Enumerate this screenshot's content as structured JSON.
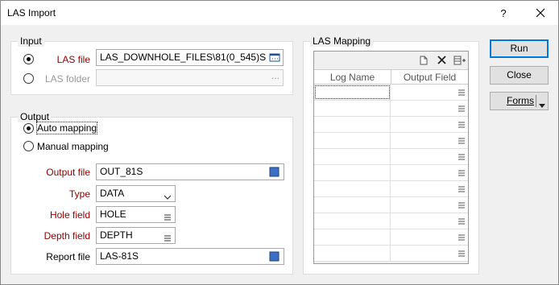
{
  "window": {
    "title": "LAS Import",
    "help_glyph": "?",
    "close_icon": "close-icon"
  },
  "input_group": {
    "label": "Input",
    "las_file": {
      "label": "LAS file",
      "value": "LAS_DOWNHOLE_FILES\\81(0_545)S",
      "selected": true
    },
    "las_folder": {
      "label": "LAS folder",
      "value": "",
      "button": "...",
      "selected": false
    }
  },
  "output_group": {
    "label": "Output",
    "auto_mapping": {
      "label": "Auto mapping",
      "selected": true
    },
    "manual_mapping": {
      "label": "Manual mapping",
      "selected": false
    },
    "output_file": {
      "label": "Output file",
      "value": "OUT_81S"
    },
    "type": {
      "label": "Type",
      "value": "DATA"
    },
    "hole_field": {
      "label": "Hole field",
      "value": "HOLE"
    },
    "depth_field": {
      "label": "Depth field",
      "value": "DEPTH"
    },
    "report_file": {
      "label": "Report file",
      "value": "LAS-81S"
    }
  },
  "mapping": {
    "label": "LAS Mapping",
    "columns": [
      "Log Name",
      "Output Field"
    ],
    "rows": [
      "",
      "",
      "",
      "",
      "",
      "",
      "",
      "",
      "",
      "",
      ""
    ]
  },
  "buttons": {
    "run": "Run",
    "close": "Close",
    "forms": "Forms"
  },
  "colors": {
    "required_label": "#8b0000",
    "accent": "#0078d7",
    "file_icon": "#3a6fc4"
  }
}
